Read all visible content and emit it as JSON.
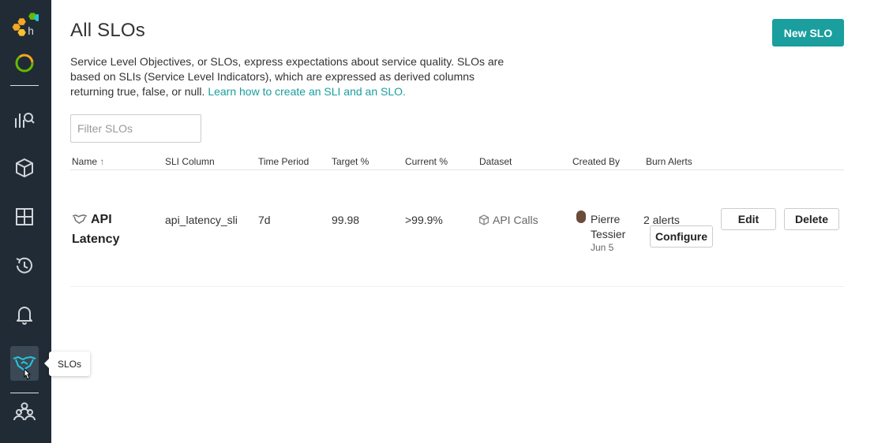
{
  "sidebar": {
    "tooltip": "SLOs"
  },
  "page": {
    "title": "All SLOs",
    "new_button": "New SLO",
    "description": "Service Level Objectives, or SLOs, express expectations about service quality. SLOs are based on SLIs (Service Level Indicators), which are expressed as derived columns returning true, false, or null.",
    "description_link": "Learn how to create an SLI and an SLO.",
    "filter_placeholder": "Filter SLOs"
  },
  "table": {
    "headers": [
      "Name",
      "SLI Column",
      "Time Period",
      "Target %",
      "Current %",
      "Dataset",
      "Created By",
      "Burn Alerts"
    ],
    "sort_indicator": "↑",
    "rows": [
      {
        "name": "API Latency",
        "sli_column": "api_latency_sli",
        "time_period": "7d",
        "target": "99.98",
        "current": ">99.9%",
        "dataset": "API Calls",
        "created_by": "Pierre Tessier",
        "created_date": "Jun 5",
        "burn_alerts": "2 alerts",
        "configure_label": "Configure",
        "edit_label": "Edit",
        "delete_label": "Delete"
      }
    ]
  },
  "colors": {
    "accent": "#1a9e9e",
    "sidebar_bg": "#212b35"
  }
}
